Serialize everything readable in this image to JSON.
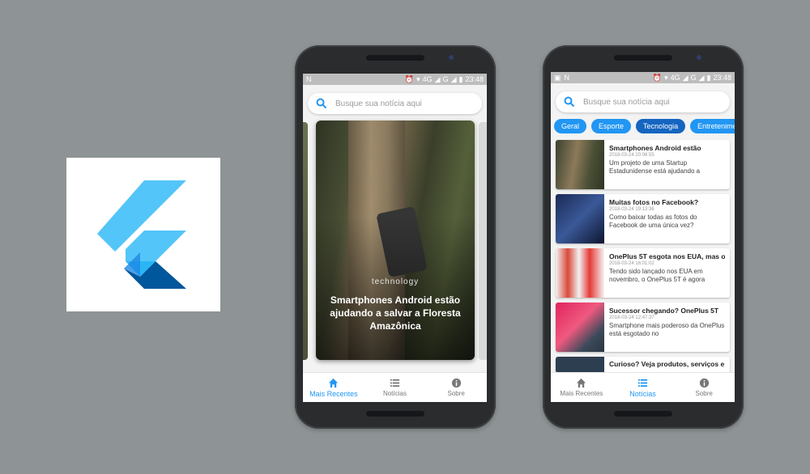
{
  "status_bar": {
    "time": "23:48",
    "network": "4G",
    "carrier": "G"
  },
  "search": {
    "placeholder": "Busque sua notícia aqui"
  },
  "phone1": {
    "feature": {
      "category": "technology",
      "title": "Smartphones Android estão ajudando a salvar a Floresta Amazônica"
    },
    "nav": [
      {
        "label": "Mais Recentes",
        "icon": "home-icon",
        "active": true
      },
      {
        "label": "Notícias",
        "icon": "list-icon",
        "active": false
      },
      {
        "label": "Sobre",
        "icon": "info-icon",
        "active": false
      }
    ]
  },
  "phone2": {
    "chips": [
      "Geral",
      "Esporte",
      "Tecnologia",
      "Entreteniment"
    ],
    "selected_chip": "Tecnologia",
    "news": [
      {
        "title": "Smartphones Android estão",
        "date": "2018-03-24 20:06:55",
        "desc": "Um projeto de uma Startup Estadunidense está ajudando a"
      },
      {
        "title": "Muitas fotos no Facebook?",
        "date": "2018-03-24 19:13:36",
        "desc": "Como baixar todas as fotos do Facebook de uma única vez?"
      },
      {
        "title": "OnePlus 5T esgota nos EUA, mas o",
        "date": "2018-03-24 16:01:02",
        "desc": "Tendo sido lançado nos EUA em novembro, o OnePlus 5T é agora"
      },
      {
        "title": "Sucessor chegando? OnePlus 5T",
        "date": "2018-03-24 12:47:37",
        "desc": "Smartphone mais poderoso da OnePlus está esgotado no"
      },
      {
        "title": "Curioso? Veja produtos, serviços e",
        "date": "",
        "desc": ""
      }
    ],
    "nav": [
      {
        "label": "Mais Recentes",
        "icon": "home-icon",
        "active": false
      },
      {
        "label": "Notícias",
        "icon": "list-icon",
        "active": true
      },
      {
        "label": "Sobre",
        "icon": "info-icon",
        "active": false
      }
    ]
  },
  "colors": {
    "accent": "#2196f3",
    "chip_selected": "#1565c0",
    "background": "#8e9495"
  }
}
